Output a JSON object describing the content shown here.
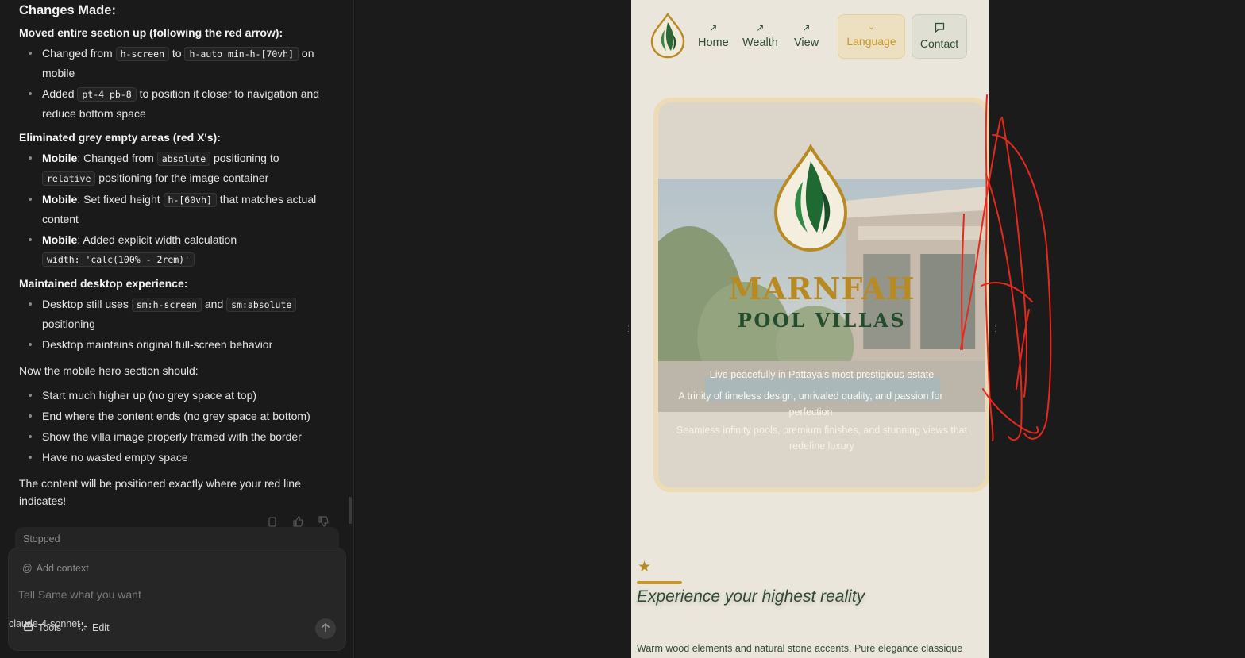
{
  "chat": {
    "heading": "Changes Made:",
    "sections": [
      {
        "title": "Moved entire section up (following the red arrow):",
        "items": [
          {
            "lead": "",
            "t1": "Changed from ",
            "c1": "h-screen",
            "t2": " to ",
            "c2": "h-auto min-h-[70vh]",
            "t3": " on mobile"
          },
          {
            "lead": "",
            "t1": "Added ",
            "c1": "pt-4 pb-8",
            "t2": " to position it closer to navigation and reduce bottom space"
          }
        ]
      },
      {
        "title": "Eliminated grey empty areas (red X's):",
        "items": [
          {
            "lead": "Mobile",
            "t1": ": Changed from ",
            "c1": "absolute",
            "t2": " positioning to ",
            "c2": "relative",
            "t3": " positioning for the image container"
          },
          {
            "lead": "Mobile",
            "t1": ": Set fixed height ",
            "c1": "h-[60vh]",
            "t2": " that matches actual content"
          },
          {
            "lead": "Mobile",
            "t1": ": Added explicit width calculation ",
            "c1": "width: 'calc(100% - 2rem)'"
          }
        ]
      },
      {
        "title": "Maintained desktop experience:",
        "items": [
          {
            "lead": "",
            "t1": "Desktop still uses ",
            "c1": "sm:h-screen",
            "t2": " and ",
            "c2": "sm:absolute",
            "t3": " positioning"
          },
          {
            "lead": "",
            "t1": "Desktop maintains original full-screen behavior"
          }
        ]
      }
    ],
    "intro": "Now the mobile hero section should:",
    "should_list": [
      "Start much higher up (no grey space at top)",
      "End where the content ends (no grey space at bottom)",
      "Show the villa image properly framed with the border",
      "Have no wasted empty space"
    ],
    "closing": "The content will be positioned exactly where your red line indicates!"
  },
  "composer": {
    "status": "Stopped",
    "add_context": "Add context",
    "placeholder": "Tell Same what you want",
    "tools": "Tools",
    "edit": "Edit",
    "model": "claude-4-sonnet"
  },
  "site": {
    "nav": {
      "home": "Home",
      "wealth": "Wealth",
      "view": "View",
      "language": "Language",
      "contact": "Contact"
    },
    "brand_line1": "MARNFAH",
    "brand_line2": "POOL VILLAS",
    "tagline1": "Live peacefully in Pattaya's most prestigious estate",
    "tagline2": "A trinity of timeless design, unrivaled quality, and passion for perfection",
    "tagline3": "Seamless infinity pools, premium finishes, and stunning views that redefine luxury",
    "section_title": "Experience your highest reality",
    "section_desc": "Warm wood elements and natural stone accents. Pure elegance classique"
  },
  "colors": {
    "gold": "#c8962a",
    "forest_green": "#2d4a2f",
    "cream": "#ebe6dc",
    "annotation_red": "#e8281d"
  }
}
